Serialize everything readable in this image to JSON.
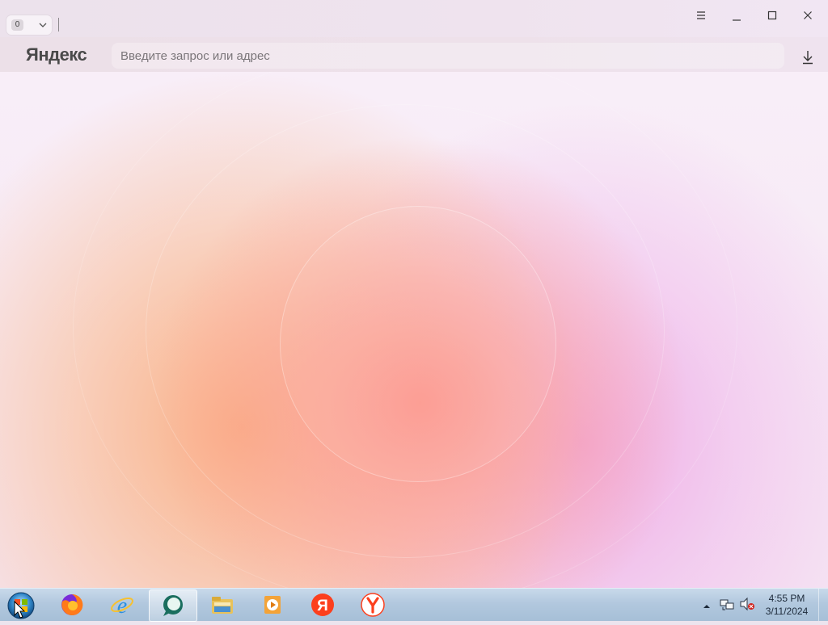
{
  "titlebar": {
    "tab_count": "0"
  },
  "toolbar": {
    "logo": "Яндекс",
    "address_placeholder": "Введите запрос или адрес",
    "address_value": ""
  },
  "taskbar": {
    "apps": [
      {
        "name": "Firefox",
        "icon": "firefox-icon"
      },
      {
        "name": "Internet Explorer",
        "icon": "internet-explorer-icon"
      },
      {
        "name": "Edge Chat",
        "icon": "chat-bubble-icon",
        "active": true
      },
      {
        "name": "File Explorer",
        "icon": "folder-icon"
      },
      {
        "name": "Media Player",
        "icon": "media-player-icon"
      },
      {
        "name": "Yandex",
        "icon": "yandex-ya-icon"
      },
      {
        "name": "Yandex Browser",
        "icon": "yandex-browser-icon"
      }
    ],
    "clock": {
      "time": "4:55 PM",
      "date": "3/11/2024"
    }
  },
  "colors": {
    "yandex_red": "#fc3f1d",
    "taskbar": "#b2c8de"
  }
}
